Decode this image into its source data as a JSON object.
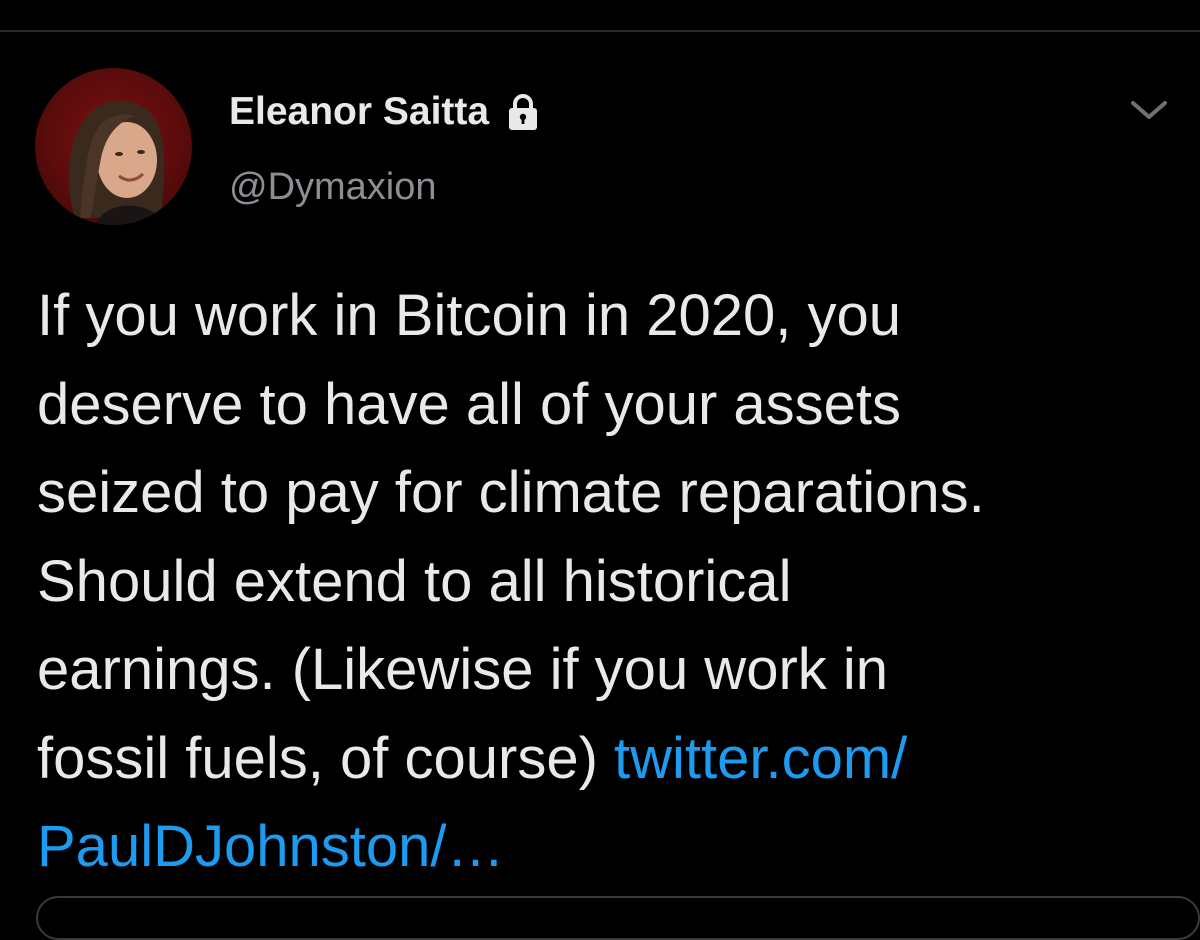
{
  "tweet": {
    "author": {
      "display_name": "Eleanor Saitta",
      "handle": "@Dymaxion",
      "protected": true
    },
    "text_lines": [
      "If you work in Bitcoin in 2020, you",
      "deserve to have all of your assets",
      "seized to pay for climate reparations.",
      "Should extend to all historical",
      "earnings. (Likewise if you work in",
      "fossil fuels, of course) "
    ],
    "link_part1": "twitter.com/",
    "link_part2": "PaulDJohnston/…"
  },
  "colors": {
    "background": "#000000",
    "text": "#e7e9ea",
    "secondary_text": "#8b8f94",
    "link": "#1d9bf0",
    "avatar_background": "#7a1010"
  },
  "icons": {
    "protected_badge": "lock-icon",
    "menu": "chevron-down-icon"
  }
}
